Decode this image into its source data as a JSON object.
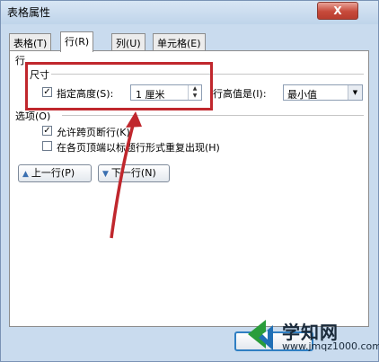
{
  "window": {
    "title": "表格属性",
    "close_glyph": "X"
  },
  "tabs": [
    {
      "label": "表格(T)"
    },
    {
      "label": "行(R)"
    },
    {
      "label": "列(U)"
    },
    {
      "label": "单元格(E)"
    }
  ],
  "panel": {
    "section_row": "行",
    "size": {
      "heading": "尺寸",
      "specify_height": {
        "label": "指定高度(S):",
        "checked": true
      },
      "height_value": "1 厘米",
      "row_height_is_label": "行高值是(I):",
      "row_height_is_value": "最小值"
    },
    "options": {
      "heading": "选项(O)",
      "allow_break": {
        "label": "允许跨页断行(K)",
        "checked": true
      },
      "repeat_header": {
        "label": "在各页顶端以标题行形式重复出现(H)",
        "checked": false
      }
    },
    "prev_row_button": "上一行(P)",
    "next_row_button": "下一行(N)"
  },
  "annotation_color": "#c0272d",
  "watermark": {
    "main": "学知网",
    "url": "www.jmqz1000.com"
  }
}
